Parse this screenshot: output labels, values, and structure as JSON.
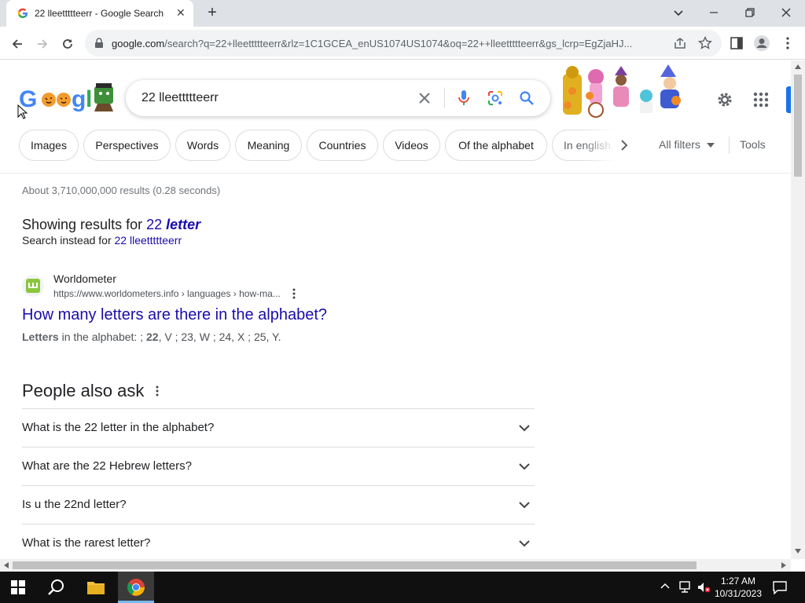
{
  "browser": {
    "tab_title": "22 lleettttteerr - Google Search",
    "url_host": "google.com",
    "url_rest": "/search?q=22+lleettttteerr&rlz=1C1GCEA_enUS1074US1074&oq=22++lleettttteerr&gs_lcrp=EgZjaHJ..."
  },
  "search": {
    "query": "22 lleettttteerr"
  },
  "chips": [
    "Images",
    "Perspectives",
    "Words",
    "Meaning",
    "Countries",
    "Videos",
    "Of the alphabet",
    "In english"
  ],
  "filters": {
    "all_filters": "All filters",
    "tools": "Tools"
  },
  "results_stats": "About 3,710,000,000 results (0.28 seconds)",
  "spelling": {
    "showing_prefix": "Showing results for ",
    "corrected_num": "22",
    "corrected_word": "letter",
    "instead_prefix": "Search instead for ",
    "original": "22 lleettttteerr"
  },
  "result": {
    "site_name": "Worldometer",
    "site_url": "https://www.worldometers.info › languages › how-ma...",
    "title": "How many letters are there in the alphabet?",
    "snippet_bold1": "Letters",
    "snippet_text1": " in the alphabet: ; ",
    "snippet_bold2": "22",
    "snippet_text2": ", V ; 23, W ; 24, X ; 25, Y."
  },
  "paa": {
    "heading": "People also ask",
    "questions": [
      "What is the 22 letter in the alphabet?",
      "What are the 22 Hebrew letters?",
      "Is u the 22nd letter?",
      "What is the rarest letter?"
    ]
  },
  "taskbar": {
    "time": "1:27 AM",
    "date": "10/31/2023"
  },
  "colors": {
    "link": "#1a0dab",
    "accent_blue": "#1a73e8",
    "muted": "#70757a"
  }
}
